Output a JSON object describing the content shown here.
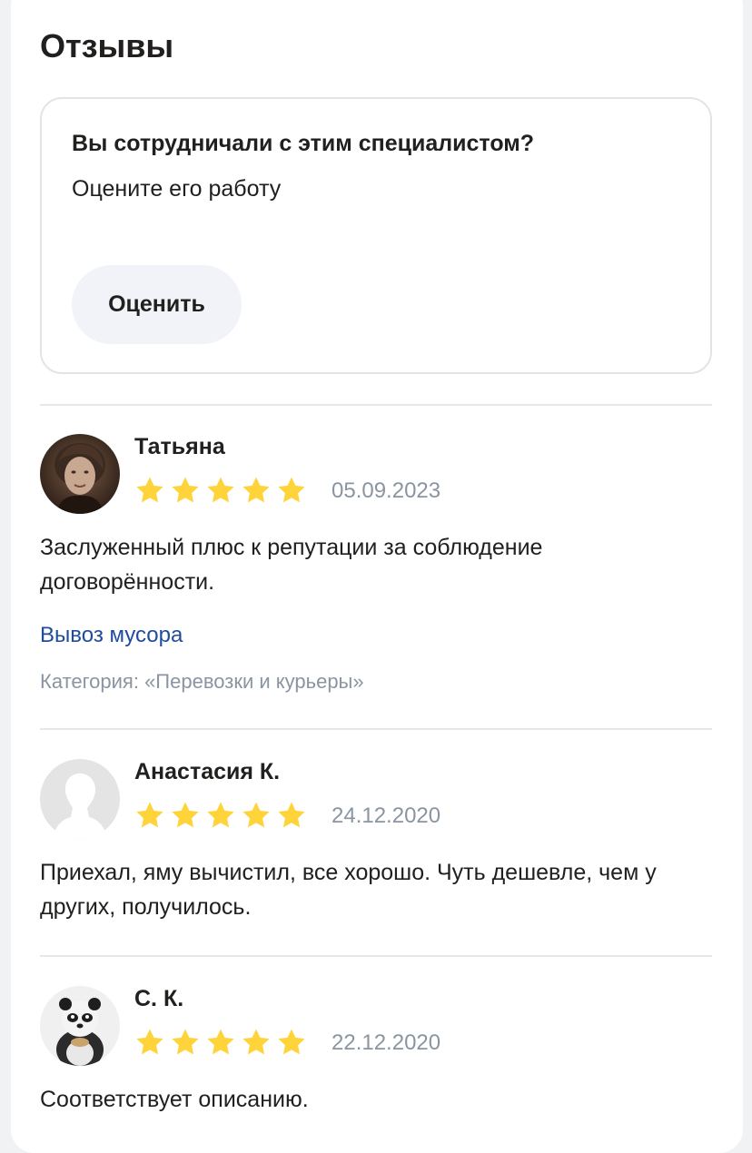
{
  "section": {
    "title": "Отзывы"
  },
  "promo": {
    "question": "Вы сотрудничали с этим специалистом?",
    "subtitle": "Оцените его работу",
    "button_label": "Оценить"
  },
  "colors": {
    "star": "#ffd43a",
    "link": "#1f4c9c",
    "muted": "#8a95a1"
  },
  "reviews": [
    {
      "author": "Татьяна",
      "rating": 5,
      "date": "05.09.2023",
      "text": "Заслуженный плюс к репутации за соблюдение договорённости.",
      "service": "Вывоз мусора",
      "category": "Категория: «Перевозки и курьеры»",
      "avatar": "photo-portrait"
    },
    {
      "author": "Анастасия К.",
      "rating": 5,
      "date": "24.12.2020",
      "text": "Приехал, яму вычистил, все хорошо. Чуть дешевле, чем у других, получилось.",
      "avatar": "default-user-silhouette"
    },
    {
      "author": "С. К.",
      "rating": 5,
      "date": "22.12.2020",
      "text": "Соответствует описанию.",
      "avatar": "panda-character"
    }
  ]
}
